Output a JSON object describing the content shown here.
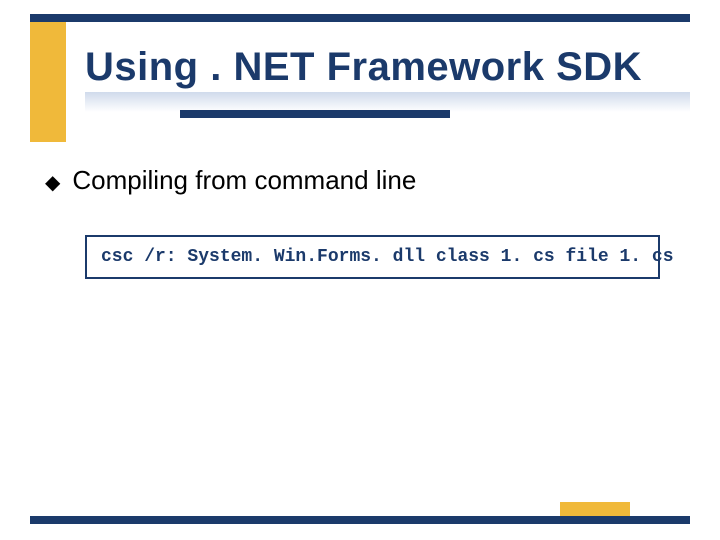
{
  "slide": {
    "title": "Using . NET Framework SDK",
    "bullet": "Compiling from command line",
    "code": "csc /r: System. Win.Forms. dll class 1. cs file 1. cs"
  },
  "colors": {
    "accent_dark": "#1b3a6b",
    "accent_gold": "#f0b93a"
  }
}
